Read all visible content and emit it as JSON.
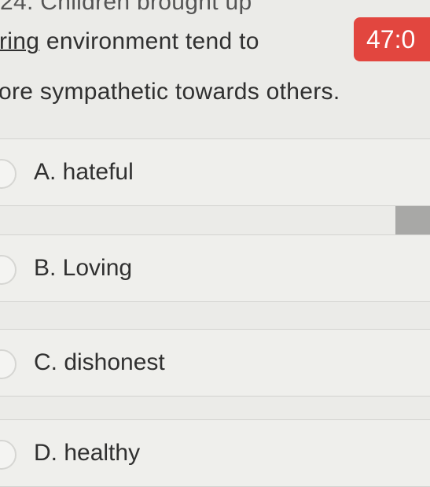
{
  "question": {
    "line1": "24. Children brought up",
    "line2_underlined": "ring",
    "line2_rest": " environment tend to",
    "line3": "ore sympathetic towards others."
  },
  "timer": {
    "text": "47:0"
  },
  "options": [
    {
      "label": "A. hateful"
    },
    {
      "label": "B. Loving"
    },
    {
      "label": "C. dishonest"
    },
    {
      "label": "D. healthy"
    }
  ],
  "colors": {
    "timer_bg": "#e2463f",
    "background": "#ebebe8"
  }
}
